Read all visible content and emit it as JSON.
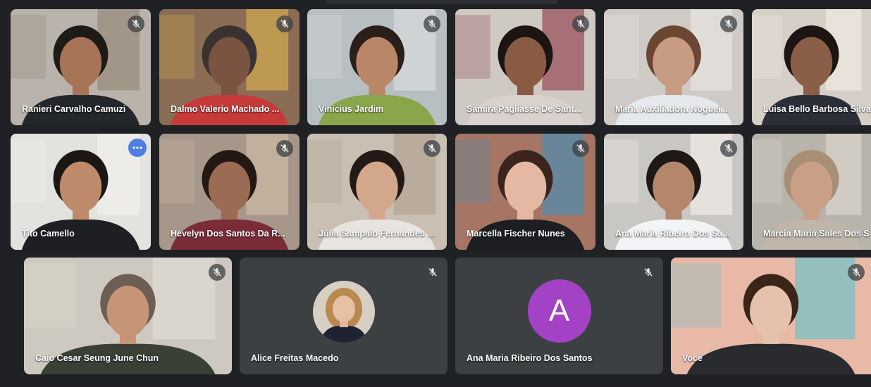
{
  "participants": [
    {
      "name": "Ranieri Carvalho Camuzi",
      "muted": true,
      "bg": "#b9b3ab",
      "wall": "#9c8f7f",
      "skin": "#a77458",
      "hair": "#1e1a17",
      "shirt": "#23262b"
    },
    {
      "name": "Dalmo Valerio Machado ...",
      "muted": true,
      "bg": "#8a6d54",
      "wall": "#c9a24f",
      "skin": "#7a5441",
      "hair": "#3a3230",
      "shirt": "#c73a3a"
    },
    {
      "name": "Vinicius Jardim",
      "muted": true,
      "bg": "#b7bfc3",
      "wall": "#d4d8da",
      "skin": "#b98768",
      "hair": "#2a1f1a",
      "shirt": "#8aa64b"
    },
    {
      "name": "Samira Pagliasse De Sant...",
      "muted": true,
      "bg": "#cfc9c3",
      "wall": "#9b5a63",
      "skin": "#8a5b44",
      "hair": "#1b1412",
      "shirt": "#d9d2cc"
    },
    {
      "name": "Maria Auxiliadora Noguei...",
      "muted": true,
      "bg": "#cfcac5",
      "wall": "#e4e1dd",
      "skin": "#c79c83",
      "hair": "#6b4633",
      "shirt": "#e6e9ec"
    },
    {
      "name": "Luisa Bello Barbosa Silva",
      "muted": false,
      "bg": "#d6cfc7",
      "wall": "#ece6df",
      "skin": "#8b5e47",
      "hair": "#1c1512",
      "shirt": "#2c2f38"
    },
    {
      "name": "Tito Camello",
      "muted": false,
      "active": true,
      "bg": "#e2e2de",
      "wall": "#f0efeb",
      "skin": "#bd8a6c",
      "hair": "#1c1715",
      "shirt": "#1d1f22"
    },
    {
      "name": "Hevelyn Dos Santos Da R...",
      "muted": true,
      "bg": "#a7968a",
      "wall": "#c9b7a4",
      "skin": "#9c6b54",
      "hair": "#231813",
      "shirt": "#7a2c38"
    },
    {
      "name": "Júlia Sampaio Fernandes ...",
      "muted": true,
      "bg": "#c9bfb3",
      "wall": "#b5a796",
      "skin": "#d3a78c",
      "hair": "#241a15",
      "shirt": "#e8e4df"
    },
    {
      "name": "Marcella Fischer Nunes",
      "muted": true,
      "bg": "#a67564",
      "wall": "#5a8aa8",
      "skin": "#e4b8a3",
      "hair": "#3a241b",
      "shirt": "#1d1e22"
    },
    {
      "name": "Ana Maria Ribeiro Dos Sa...",
      "muted": true,
      "bg": "#c9c7c3",
      "wall": "#ece9e4",
      "skin": "#b4876d",
      "hair": "#1f1815",
      "shirt": "#f2f4f6"
    },
    {
      "name": "Marcia Maria Sales Dos S",
      "muted": false,
      "bg": "#b7b4ac",
      "wall": "#d6d2ca",
      "skin": "#c9a087",
      "hair": "#a88e74",
      "shirt": "#bfb5a8"
    },
    {
      "name": "Caio Cesar Seung June Chun",
      "muted": true,
      "bg": "#cdc9c1",
      "wall": "#ded9cf",
      "skin": "#c69577",
      "hair": "#6d5d52",
      "shirt": "#3a4036"
    },
    {
      "name": "Alice Freitas Macedo",
      "muted": true,
      "avatar": "photo"
    },
    {
      "name": "Ana Maria Ribeiro Dos Santos",
      "muted": true,
      "avatar": "letter",
      "letter": "A",
      "avatar_color": "#a342c4"
    },
    {
      "name": "Você",
      "muted": true,
      "bg": "#e9b9a8",
      "wall": "#7fc0c2",
      "skin": "#e6c2ae",
      "hair": "#3a2519",
      "shirt": "#2a2b2f"
    }
  ]
}
